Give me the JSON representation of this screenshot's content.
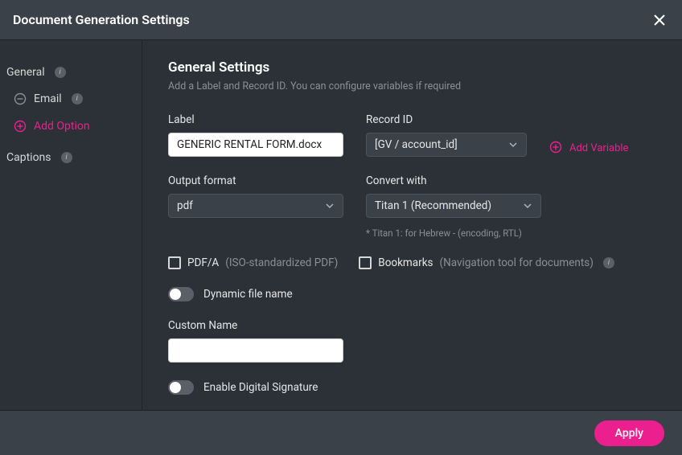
{
  "header": {
    "title": "Document Generation Settings"
  },
  "sidebar": {
    "general": "General",
    "email": "Email",
    "add_option": "Add Option",
    "captions": "Captions"
  },
  "main": {
    "heading": "General Settings",
    "hint": "Add a Label and Record ID. You can configure variables if required",
    "label_field": {
      "label": "Label",
      "value": "GENERIC RENTAL FORM.docx"
    },
    "record_id": {
      "label": "Record ID",
      "value": "[GV / account_id]"
    },
    "add_variable": "Add Variable",
    "output_format": {
      "label": "Output format",
      "value": "pdf"
    },
    "convert_with": {
      "label": "Convert with",
      "value": "Titan 1 (Recommended)",
      "note": "* Titan 1: for Hebrew - (encoding, RTL)"
    },
    "pdfa": {
      "label": "PDF/A",
      "sub": "(ISO-standardized PDF)"
    },
    "bookmarks": {
      "label": "Bookmarks",
      "sub": "(Navigation tool for documents)"
    },
    "dynamic_filename": "Dynamic file name",
    "custom_name": {
      "label": "Custom Name",
      "value": ""
    },
    "digital_sig": "Enable Digital Signature"
  },
  "footer": {
    "apply": "Apply"
  }
}
